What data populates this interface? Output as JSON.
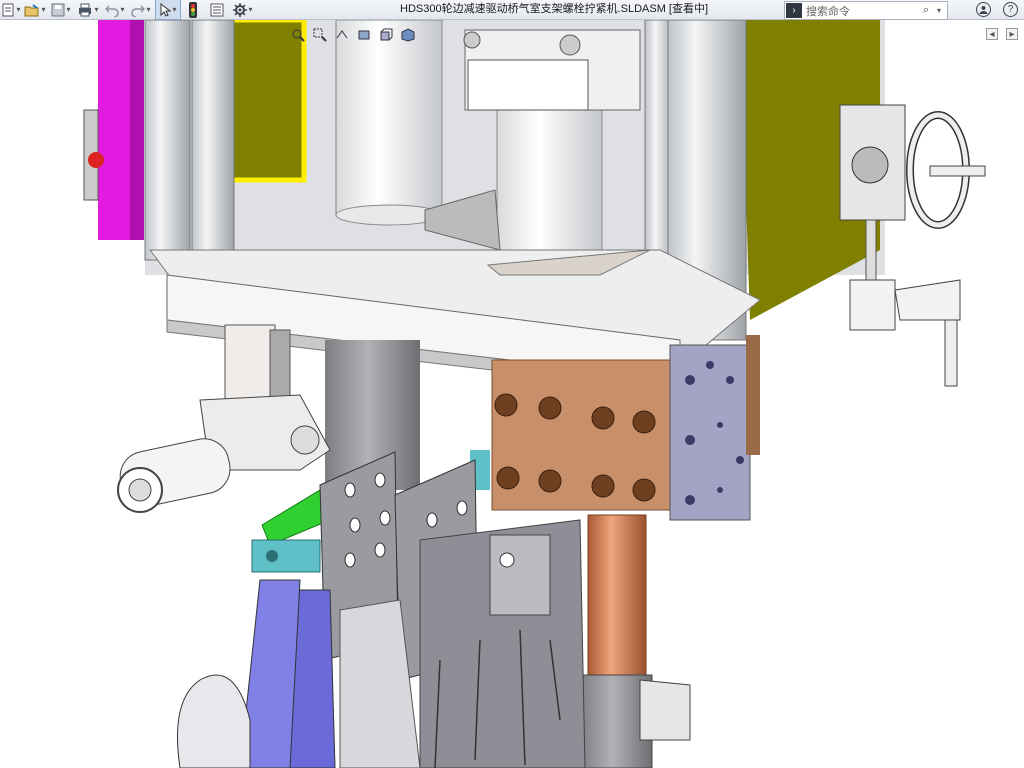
{
  "window": {
    "title": "HDS300轮边减速驱动桥气室支架螺栓拧紧机.SLDASM [查看中]"
  },
  "toolbar": {
    "items": [
      {
        "name": "new-document-icon",
        "caret": true
      },
      {
        "name": "open-icon",
        "caret": true
      },
      {
        "name": "save-icon",
        "caret": true
      },
      {
        "name": "print-icon",
        "caret": true
      },
      {
        "name": "undo-icon",
        "caret": true
      },
      {
        "name": "redo-icon",
        "caret": true
      },
      {
        "name": "select-arrow-icon",
        "caret": true
      },
      {
        "name": "traffic-light-icon",
        "caret": false
      },
      {
        "name": "file-properties-icon",
        "caret": false
      },
      {
        "name": "gear-icon",
        "caret": true
      }
    ]
  },
  "search": {
    "placeholder": "搜索命令"
  },
  "heads_up_toolbar": [
    "zoom-to-fit-icon",
    "zoom-area-icon",
    "previous-view-icon",
    "section-view-icon",
    "view-orientation-icon",
    "display-style-icon"
  ],
  "right_icons": [
    "user-account-icon",
    "help-icon"
  ],
  "colors": {
    "magenta_plate": "#e21be0",
    "yellow_frame": "#7f7f00",
    "copper_block": "#c8906a",
    "lavender_block": "#a3a3c6",
    "green_plate": "#2fd02f",
    "teal_bracket": "#5fc0c8",
    "blue_clamp": "#6a6ad8",
    "copper_rod": "#d6845a"
  }
}
